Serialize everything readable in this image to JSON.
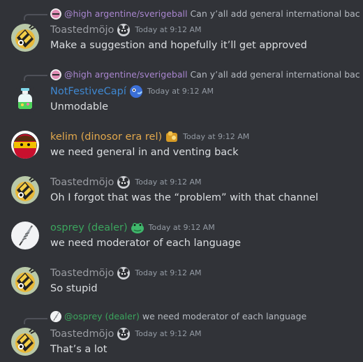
{
  "colors": {
    "background": "#313338",
    "toasted": "#9a9ca2",
    "notfestive": "#3f88d1",
    "kelim": "#e2a84c",
    "osprey": "#3ba55d",
    "sverigeball": "#a986cf",
    "mention_osprey": "#3ba55d"
  },
  "messages": [
    {
      "reply": {
        "author": "@high argentine/sverigeball",
        "text": "Can y’all add general international back",
        "avatar_icon": "sverigeball-avatar"
      },
      "author": "Toastedmöjo",
      "badge_icon": "panda-badge-icon",
      "timestamp": "Today at 9:12 AM",
      "content": "Make a suggestion and hopefully it’ll get approved",
      "avatar_icon": "bee-avatar"
    },
    {
      "reply": {
        "author": "@high argentine/sverigeball",
        "text": "Can y’all add general international back",
        "avatar_icon": "sverigeball-avatar"
      },
      "author": "NotFestiveCapí",
      "badge_icon": "blue-creature-badge-icon",
      "timestamp": "Today at 9:12 AM",
      "content": "Unmodable",
      "avatar_icon": "potion-avatar"
    },
    {
      "author": "kelim (dinosor era rel)",
      "badge_icon": "gold-badge-icon",
      "timestamp": "Today at 9:12 AM",
      "content": "we need general in and venting back",
      "avatar_icon": "flagball-avatar"
    },
    {
      "author": "Toastedmöjo",
      "badge_icon": "panda-badge-icon",
      "timestamp": "Today at 9:12 AM",
      "content": "Oh I forgot that was the “problem” with that channel",
      "avatar_icon": "bee-avatar"
    },
    {
      "author": "osprey (dealer)",
      "badge_icon": "frog-badge-icon",
      "timestamp": "Today at 9:12 AM",
      "content": "we need moderator of each language",
      "avatar_icon": "feather-avatar"
    },
    {
      "author": "Toastedmöjo",
      "badge_icon": "panda-badge-icon",
      "timestamp": "Today at 9:12 AM",
      "content": "So stupid",
      "avatar_icon": "bee-avatar"
    },
    {
      "reply": {
        "author": "@osprey (dealer)",
        "text": "we need moderator of each language",
        "avatar_icon": "feather-avatar"
      },
      "author": "Toastedmöjo",
      "badge_icon": "panda-badge-icon",
      "timestamp": "Today at 9:12 AM",
      "content": "That’s a lot",
      "avatar_icon": "bee-avatar"
    }
  ]
}
